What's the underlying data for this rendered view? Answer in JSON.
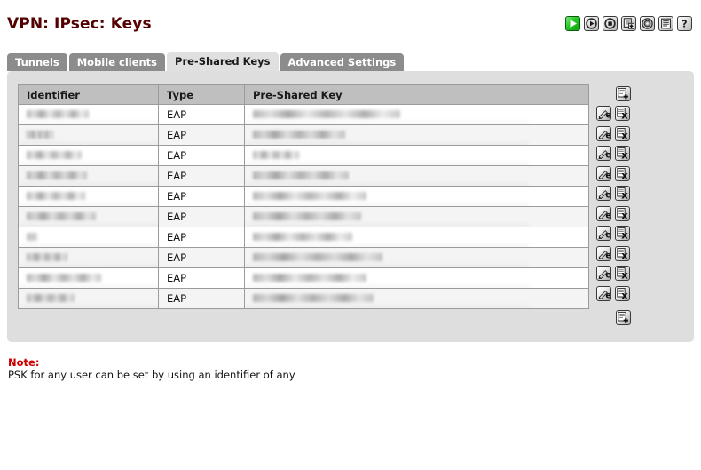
{
  "header": {
    "title": "VPN: IPsec: Keys",
    "title_color": "#550000",
    "icons": [
      {
        "name": "play-icon",
        "tooltip": "Apply changes"
      },
      {
        "name": "reboot-icon",
        "tooltip": "Reboot"
      },
      {
        "name": "halt-icon",
        "tooltip": "Halt"
      },
      {
        "name": "add-icon",
        "tooltip": "Add"
      },
      {
        "name": "settings-icon",
        "tooltip": "Settings"
      },
      {
        "name": "log-icon",
        "tooltip": "Log"
      },
      {
        "name": "help-icon",
        "tooltip": "Help"
      }
    ]
  },
  "tabs": [
    {
      "label": "Tunnels",
      "name": "tab-tunnels",
      "active": false
    },
    {
      "label": "Mobile clients",
      "name": "tab-mobile-clients",
      "active": false
    },
    {
      "label": "Pre-Shared Keys",
      "name": "tab-pre-shared-keys",
      "active": true
    },
    {
      "label": "Advanced Settings",
      "name": "tab-advanced-settings",
      "active": false
    }
  ],
  "table": {
    "columns": [
      "Identifier",
      "Type",
      "Pre-Shared Key"
    ],
    "rows": [
      {
        "identifier": "",
        "type": "EAP",
        "key": ""
      },
      {
        "identifier": "",
        "type": "EAP",
        "key": ""
      },
      {
        "identifier": "",
        "type": "EAP",
        "key": ""
      },
      {
        "identifier": "",
        "type": "EAP",
        "key": ""
      },
      {
        "identifier": "",
        "type": "EAP",
        "key": ""
      },
      {
        "identifier": "",
        "type": "EAP",
        "key": ""
      },
      {
        "identifier": "",
        "type": "EAP",
        "key": ""
      },
      {
        "identifier": "",
        "type": "EAP",
        "key": ""
      },
      {
        "identifier": "",
        "type": "EAP",
        "key": ""
      },
      {
        "identifier": "",
        "type": "EAP",
        "key": ""
      }
    ],
    "row_actions": [
      {
        "name": "edit-icon",
        "label": "e"
      },
      {
        "name": "delete-icon",
        "label": "x"
      }
    ],
    "add_top": {
      "name": "add-row-icon-top"
    },
    "add_bottom": {
      "name": "add-row-icon-bottom"
    }
  },
  "note": {
    "label": "Note:",
    "text": "PSK for any user can be set by using an identifier of any",
    "label_color": "#cc0000"
  },
  "colors": {
    "panel_bg": "#dedede",
    "tab_inactive": "#8c8c8c",
    "tab_active": "#e0e0e0",
    "table_header": "#bfbfbf",
    "border": "#9b9b9b",
    "row_alt": "#f4f4f4"
  }
}
